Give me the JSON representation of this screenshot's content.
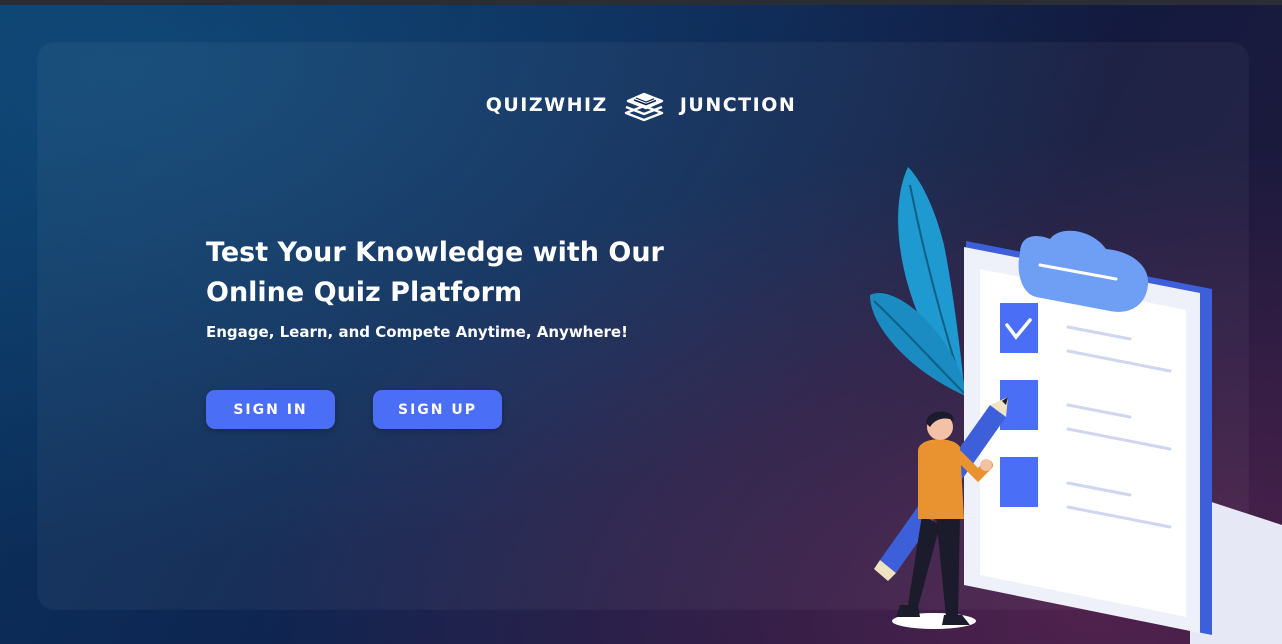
{
  "brand": {
    "left": "QUIZWHIZ",
    "right": "JUNCTION",
    "icon": "stacked-books-icon"
  },
  "hero": {
    "title_line1": "Test Your Knowledge with Our",
    "title_line2": "Online Quiz Platform",
    "subtitle": "Engage, Learn, and Compete Anytime, Anywhere!"
  },
  "actions": {
    "sign_in": "SIGN IN",
    "sign_up": "SIGN UP"
  },
  "illustration": {
    "subject": "person-with-pencil-and-checklist-clipboard",
    "checklist_items_checked": [
      true,
      false,
      false
    ]
  },
  "colors": {
    "accent": "#4a6ef5",
    "clipboard": "#3d5fd9",
    "leaf": "#1e9ad0",
    "shirt": "#e8932f"
  }
}
